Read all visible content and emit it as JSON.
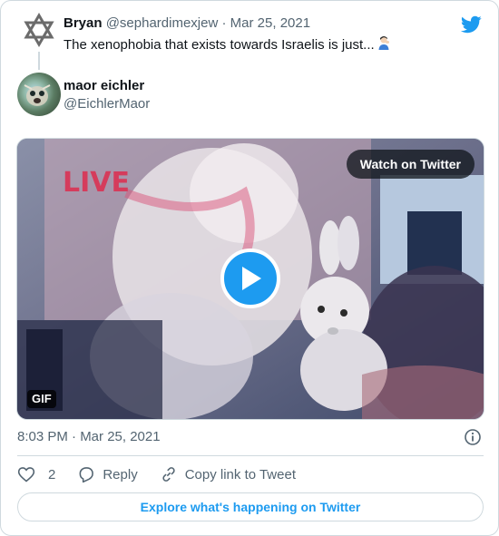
{
  "parent_tweet": {
    "author_name": "Bryan",
    "author_handle": "@sephardimexjew",
    "separator": "·",
    "date": "Mar 25, 2021",
    "text": "The xenophobia that exists towards Israelis is just..."
  },
  "tweet": {
    "author_name": "maor eichler",
    "author_handle": "@EichlerMaor",
    "timestamp": "8:03 PM · Mar 25, 2021"
  },
  "media": {
    "watch_label": "Watch on Twitter",
    "gif_label": "GIF",
    "overlay_text": "LIVE"
  },
  "actions": {
    "like_count": "2",
    "reply_label": "Reply",
    "copy_link_label": "Copy link to Tweet"
  },
  "explore_label": "Explore what's happening on Twitter",
  "colors": {
    "brand": "#1d9bf0",
    "text_primary": "#0f1419",
    "text_secondary": "#536471",
    "border": "#cfd9de"
  },
  "icons": [
    "star-of-david-avatar",
    "twitter-bird-icon",
    "play-icon",
    "info-icon",
    "heart-icon",
    "reply-icon",
    "link-icon"
  ]
}
